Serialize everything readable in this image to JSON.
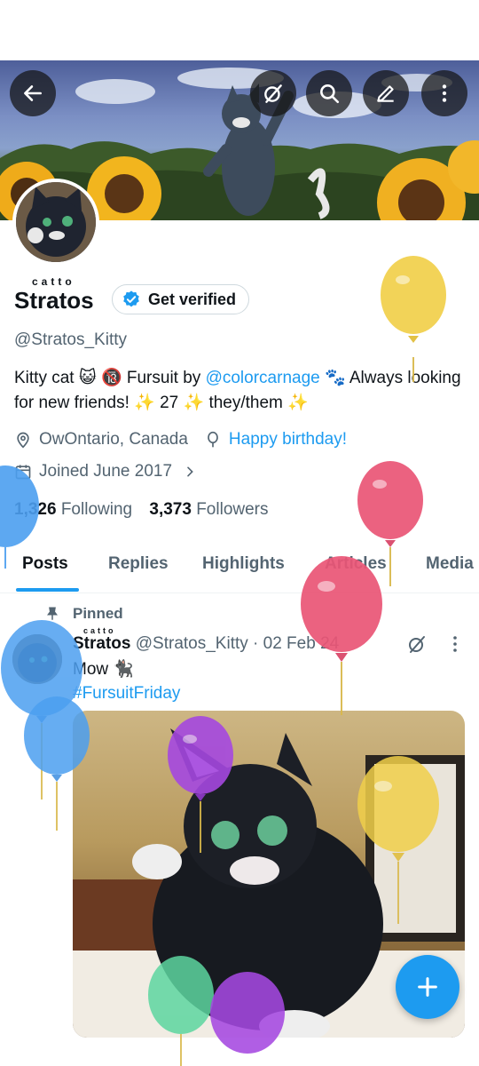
{
  "profile": {
    "name_small": "catto",
    "name": "Stratos",
    "verify_label": "Get verified",
    "handle": "@Stratos_Kitty",
    "bio_part1": "Kitty cat 😺 🔞 Fursuit by ",
    "bio_link": "@colorcarnage",
    "bio_part2": " 🐾 Always looking for new friends! ✨ 27 ✨ they/them ✨",
    "location": "OwOntario, Canada",
    "birthday": "Happy birthday!",
    "joined": "Joined June 2017",
    "following_count": "1,326",
    "following_label": "Following",
    "followers_count": "3,373",
    "followers_label": "Followers"
  },
  "tabs": [
    {
      "label": "Posts"
    },
    {
      "label": "Replies"
    },
    {
      "label": "Highlights"
    },
    {
      "label": "Articles"
    },
    {
      "label": "Media"
    }
  ],
  "post": {
    "pinned_label": "Pinned",
    "name_small": "catto",
    "name": "Stratos",
    "handle_date": "@Stratos_Kitty · 02 Feb 24",
    "text": "Mow 🐈‍⬛",
    "hashtag": "#FursuitFriday"
  },
  "icons": {
    "back": "back-arrow-icon",
    "grok": "grok-icon",
    "search": "search-icon",
    "edit": "edit-icon",
    "more": "more-vertical-icon",
    "location": "location-pin-icon",
    "birthday": "balloon-icon",
    "calendar": "calendar-icon",
    "pin": "pin-icon",
    "compose": "plus-icon"
  },
  "colors": {
    "accent": "#1d9bf0",
    "text": "#0f1419",
    "muted": "#536471"
  }
}
